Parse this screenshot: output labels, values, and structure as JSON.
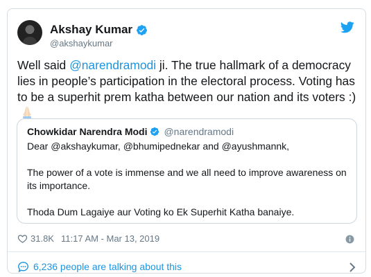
{
  "author": {
    "name": "Akshay Kumar",
    "handle": "@akshaykumar"
  },
  "tweet": {
    "text_before": "Well said ",
    "mention": "@narendramodi",
    "text_after": " ji. The true hallmark of a democracy lies in people’s participation in the electoral process. Voting has to be a superhit prem katha between our nation and its voters :)",
    "emoji": "folded-hands-emoji"
  },
  "quoted": {
    "name": "Chowkidar Narendra Modi",
    "handle": "@narendramodi",
    "paragraphs": [
      "Dear @akshaykumar, @bhumipednekar and @ayushmannk,",
      "The power of a vote is immense and we all need to improve awareness on its importance.",
      "Thoda Dum Lagaiye aur Voting ko Ek Superhit Katha banaiye."
    ]
  },
  "meta": {
    "likes": "31.8K",
    "timestamp": "11:17 AM - Mar 13, 2019"
  },
  "talking": {
    "label": "6,236 people are talking about this"
  },
  "colors": {
    "accent": "#1b95e0",
    "text": "#14171a",
    "muted": "#657786",
    "border": "#ccd6dd"
  }
}
